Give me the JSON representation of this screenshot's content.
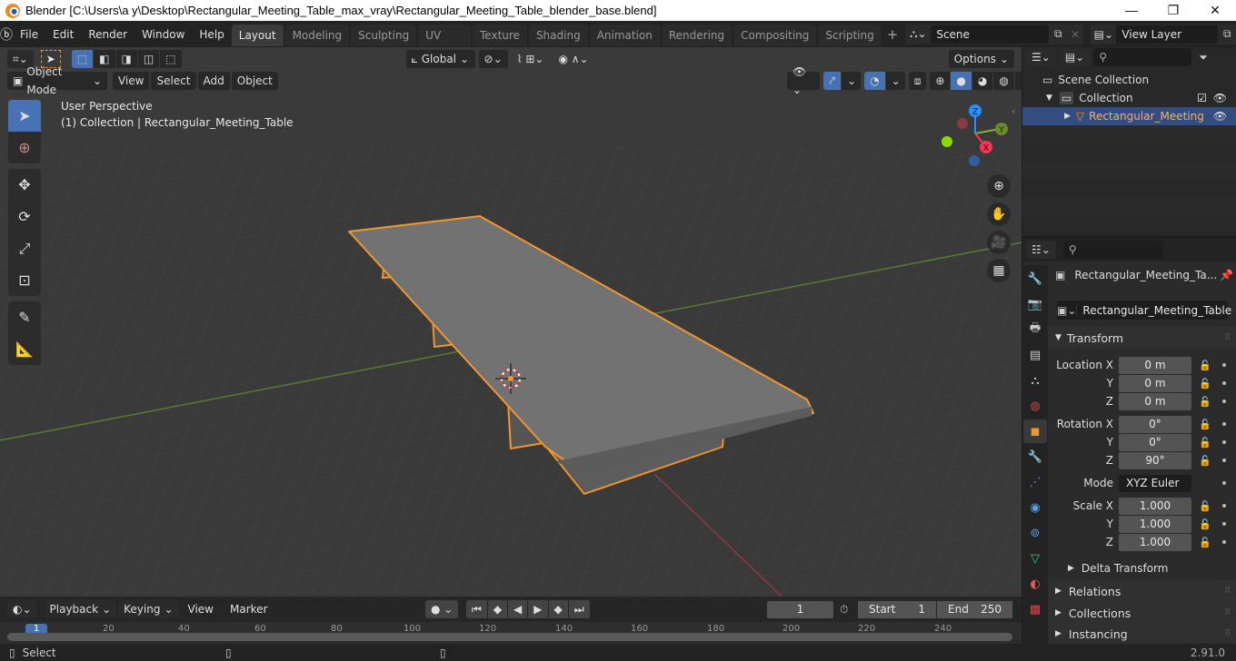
{
  "window": {
    "title": "Blender [C:\\Users\\a y\\Desktop\\Rectangular_Meeting_Table_max_vray\\Rectangular_Meeting_Table_blender_base.blend]",
    "minimize": "—",
    "maximize": "❐",
    "close": "✕"
  },
  "menu": [
    "File",
    "Edit",
    "Render",
    "Window",
    "Help"
  ],
  "workspaces": [
    {
      "label": "Layout",
      "active": true
    },
    {
      "label": "Modeling"
    },
    {
      "label": "Sculpting"
    },
    {
      "label": "UV Editing"
    },
    {
      "label": "Texture Paint"
    },
    {
      "label": "Shading"
    },
    {
      "label": "Animation"
    },
    {
      "label": "Rendering"
    },
    {
      "label": "Compositing"
    },
    {
      "label": "Scripting"
    }
  ],
  "add_workspace": "+",
  "scene": {
    "value": "Scene"
  },
  "view_layer": {
    "value": "View Layer"
  },
  "viewport_header": {
    "orientation": "Global",
    "options": "Options",
    "mode": "Object Mode",
    "menus": [
      "View",
      "Select",
      "Add",
      "Object"
    ]
  },
  "viewport": {
    "perspective": "User Perspective",
    "collection_info": "(1) Collection | Rectangular_Meeting_Table",
    "gizmo": {
      "x": "X",
      "y": "Y",
      "z": "Z"
    },
    "colors": {
      "accent": "#4772b3",
      "selection": "#f2972e",
      "x_axis": "#ff3352",
      "y_axis": "#8bdc00",
      "z_axis": "#2890ff"
    }
  },
  "outliner": {
    "scene_collection": "Scene Collection",
    "collection": "Collection",
    "object": "Rectangular_Meeting"
  },
  "properties": {
    "object_name_header": "Rectangular_Meeting_Ta...",
    "object_name": "Rectangular_Meeting_Table",
    "transform_label": "Transform",
    "location": {
      "label": "Location X",
      "x": "0 m",
      "y": "0 m",
      "z": "0 m"
    },
    "rotation": {
      "label": "Rotation X",
      "x": "0°",
      "y": "0°",
      "z": "90°"
    },
    "mode_label": "Mode",
    "mode_value": "XYZ Euler",
    "scale": {
      "label": "Scale X",
      "x": "1.000",
      "y": "1.000",
      "z": "1.000"
    },
    "axis_y": "Y",
    "axis_z": "Z",
    "delta_transform": "Delta Transform",
    "relations": "Relations",
    "collections": "Collections",
    "instancing": "Instancing"
  },
  "timeline": {
    "menus": [
      "Playback",
      "Keying",
      "View",
      "Marker"
    ],
    "current_frame": "1",
    "start_label": "Start",
    "start": "1",
    "end_label": "End",
    "end": "250",
    "ruler": [
      "1",
      "20",
      "40",
      "60",
      "80",
      "100",
      "120",
      "140",
      "160",
      "180",
      "200",
      "220",
      "240"
    ]
  },
  "status": {
    "select": "Select",
    "version": "2.91.0"
  }
}
